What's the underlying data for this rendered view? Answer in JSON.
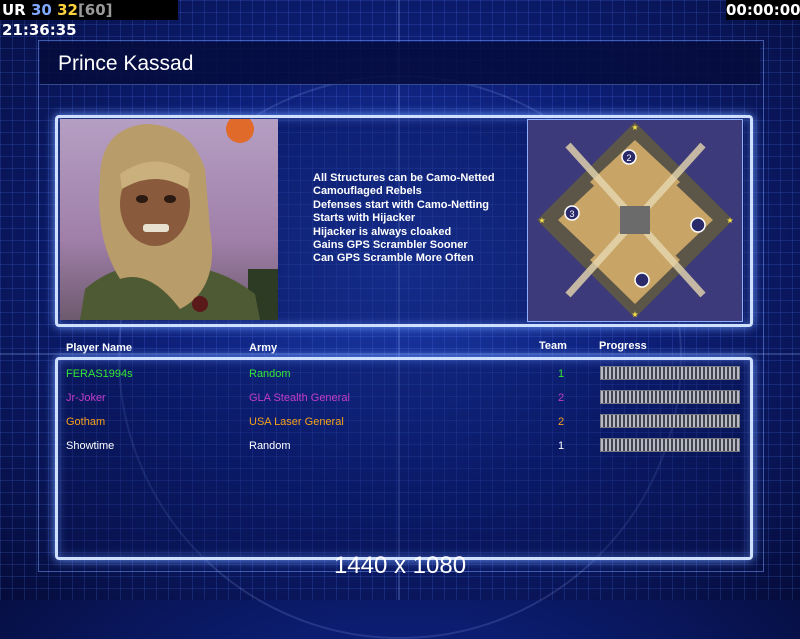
{
  "hud": {
    "prefix": "UR",
    "value_blue": "30",
    "value_yellow": "32",
    "bracket_value": "[60]",
    "clock": "21:36:35",
    "timer": "00:00:00"
  },
  "general": {
    "name": "Prince Kassad",
    "traits": [
      "All Structures can be Camo-Netted",
      "Camouflaged Rebels",
      "Defenses start with Camo-Netting",
      "Starts with Hijacker",
      "Hijacker is always cloaked",
      "Gains GPS Scrambler Sooner",
      "Can GPS Scramble More Often"
    ]
  },
  "minimap": {
    "start_markers": [
      "2",
      "3"
    ]
  },
  "table": {
    "headers": {
      "player": "Player Name",
      "army": "Army",
      "team": "Team",
      "progress": "Progress"
    },
    "rows": [
      {
        "player": "FERAS1994s",
        "army": "Random",
        "team": "1",
        "color": "#34e834",
        "progress": 0
      },
      {
        "player": "Jr-Joker",
        "army": "GLA Stealth General",
        "team": "2",
        "color": "#c43cc8",
        "progress": 0
      },
      {
        "player": "Gotham",
        "army": "USA Laser General",
        "team": "2",
        "color": "#f5a11c",
        "progress": 0
      },
      {
        "player": "Showtime",
        "army": "Random",
        "team": "1",
        "color": "#ffffff",
        "progress": 0
      }
    ]
  },
  "resolution_label": "1440 x 1080"
}
